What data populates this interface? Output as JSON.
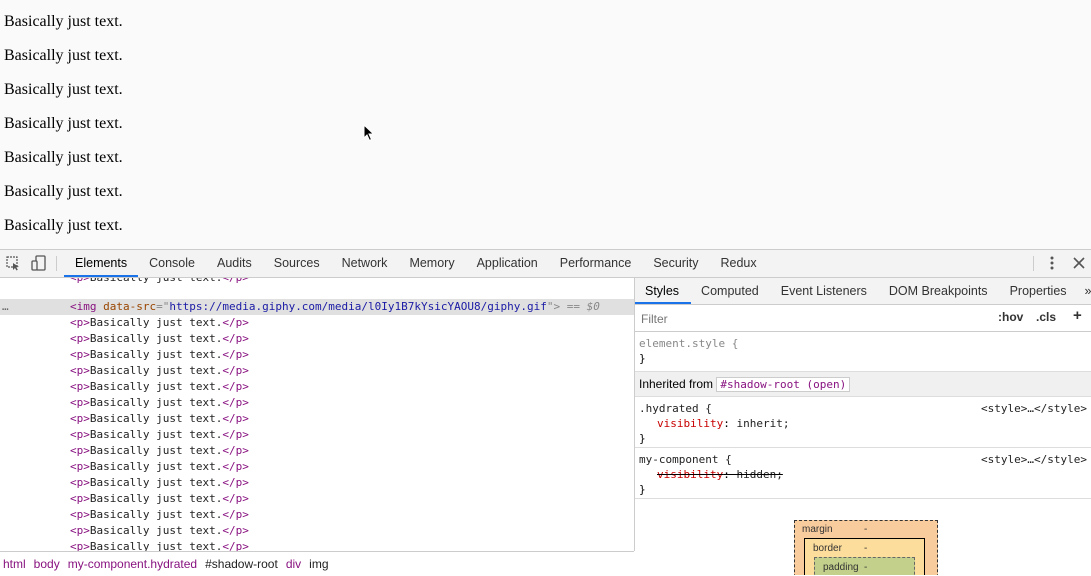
{
  "page": {
    "lines": [
      "Basically just text.",
      "Basically just text.",
      "Basically just text.",
      "Basically just text.",
      "Basically just text.",
      "Basically just text.",
      "Basically just text."
    ]
  },
  "toolbar": {
    "tabs": [
      "Elements",
      "Console",
      "Audits",
      "Sources",
      "Network",
      "Memory",
      "Application",
      "Performance",
      "Security",
      "Redux"
    ]
  },
  "dom": {
    "selected": {
      "tag_open": "<img ",
      "attr_name": "data-src",
      "attr_eq": "=\"",
      "attr_value": "https://media.giphy.com/media/l0Iy1B7kYsicYAOU8/giphy.gif",
      "attr_close": "\">",
      "marker": " == $0"
    },
    "p_open": "<p>",
    "p_text": "Basically just text.",
    "p_close": "</p>",
    "dots": "…"
  },
  "breadcrumb": [
    "html",
    "body",
    "my-component.hydrated",
    "#shadow-root",
    "div",
    "img"
  ],
  "styles": {
    "tabs": [
      "Styles",
      "Computed",
      "Event Listeners",
      "DOM Breakpoints",
      "Properties",
      "»"
    ],
    "filter_placeholder": "Filter",
    "hov": ":hov",
    "cls": ".cls",
    "add": "+",
    "element_style": "element.style {",
    "close_brace": "}",
    "inherited_label": "Inherited from",
    "inherited_tag": "#shadow-root (open)",
    "rule1": {
      "selector": ".hydrated {",
      "source": "<style>…</style>",
      "prop": "visibility",
      "value": "inherit;"
    },
    "rule2": {
      "selector": "my-component {",
      "source": "<style>…</style>",
      "prop": "visibility",
      "value": "hidden;"
    }
  },
  "boxmodel": {
    "margin": "margin",
    "margin_val": "-",
    "border": "border",
    "border_val": "-",
    "padding": "padding",
    "padding_val": "-"
  },
  "colors": {
    "accent": "#1a73e8",
    "margin": "#f9cc9d",
    "border": "#fddd9b",
    "padding": "#c3d08b"
  }
}
